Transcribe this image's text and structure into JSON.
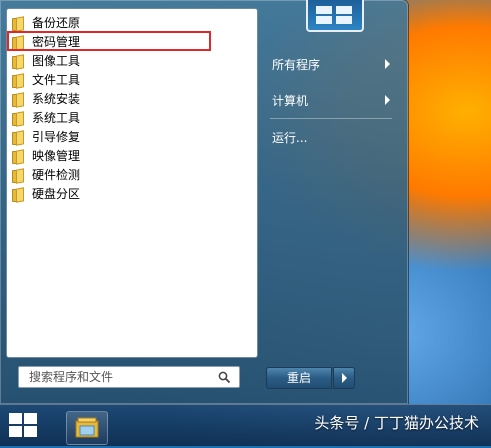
{
  "program_list": [
    {
      "label": "备份还原",
      "icon": "folder-icon"
    },
    {
      "label": "密码管理",
      "icon": "folder-icon",
      "highlighted": true
    },
    {
      "label": "图像工具",
      "icon": "folder-icon"
    },
    {
      "label": "文件工具",
      "icon": "folder-icon"
    },
    {
      "label": "系统安装",
      "icon": "folder-icon"
    },
    {
      "label": "系统工具",
      "icon": "folder-icon"
    },
    {
      "label": "引导修复",
      "icon": "folder-icon"
    },
    {
      "label": "映像管理",
      "icon": "folder-icon"
    },
    {
      "label": "硬件检测",
      "icon": "folder-icon"
    },
    {
      "label": "硬盘分区",
      "icon": "folder-icon"
    }
  ],
  "search": {
    "placeholder": "搜索程序和文件",
    "value": "",
    "icon": "search-icon"
  },
  "right_pane": {
    "all_programs": "所有程序",
    "computer": "计算机",
    "run": "运行..."
  },
  "shutdown": {
    "label": "重启"
  },
  "watermark": "头条号 / 丁丁猫办公技术",
  "colors": {
    "highlight_border": "#e0282a",
    "taskbar": "#0f2d50"
  }
}
